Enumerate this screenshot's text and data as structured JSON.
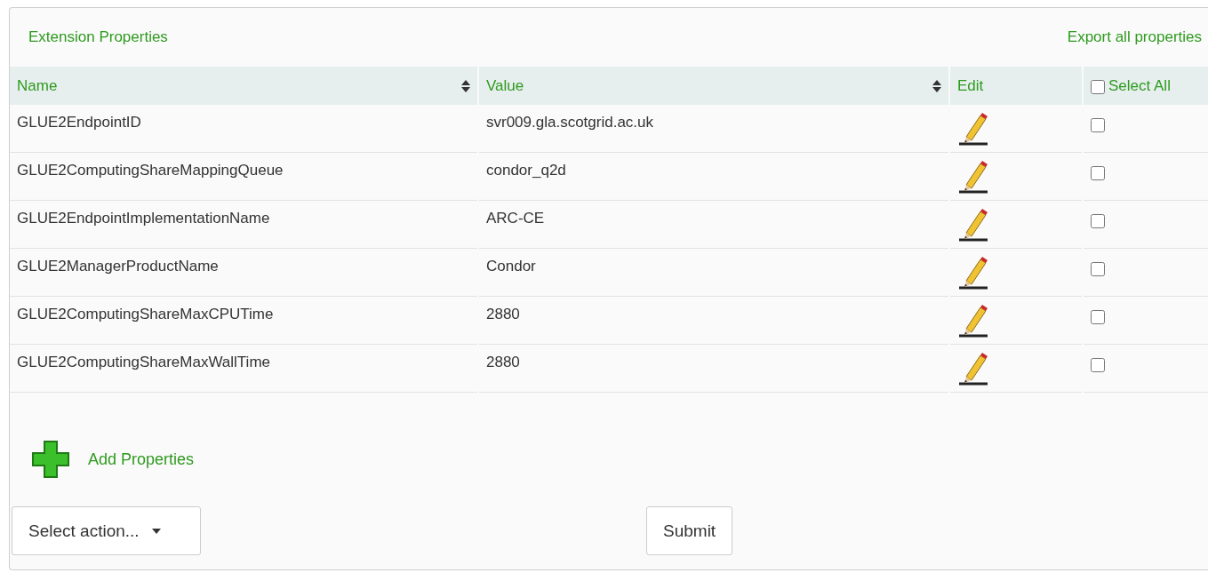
{
  "panel": {
    "title": "Extension Properties",
    "export_link": "Export all properties"
  },
  "table": {
    "columns": [
      {
        "label": "Name",
        "sortable": true
      },
      {
        "label": "Value",
        "sortable": true
      },
      {
        "label": "Edit",
        "sortable": false
      }
    ],
    "select_all": {
      "label": "Select All",
      "checked": false
    },
    "rows": [
      {
        "name": "GLUE2EndpointID",
        "value": "svr009.gla.scotgrid.ac.uk",
        "checked": false
      },
      {
        "name": "GLUE2ComputingShareMappingQueue",
        "value": "condor_q2d",
        "checked": false
      },
      {
        "name": "GLUE2EndpointImplementationName",
        "value": "ARC-CE",
        "checked": false
      },
      {
        "name": "GLUE2ManagerProductName",
        "value": "Condor",
        "checked": false
      },
      {
        "name": "GLUE2ComputingShareMaxCPUTime",
        "value": "2880",
        "checked": false
      },
      {
        "name": "GLUE2ComputingShareMaxWallTime",
        "value": "2880",
        "checked": false
      }
    ]
  },
  "add_link": "Add Properties",
  "action_select": "Select action...",
  "submit": "Submit"
}
